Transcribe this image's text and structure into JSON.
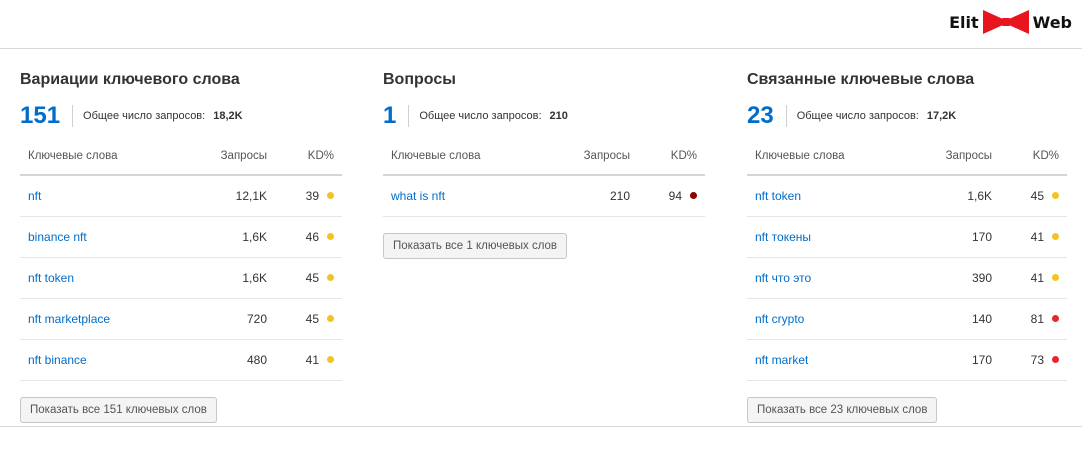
{
  "brand": {
    "left": "Elit",
    "right": "Web",
    "bow_color": "#e8141e"
  },
  "colors": {
    "accent": "#006dca",
    "kd_yellow": "#f5c224",
    "kd_red": "#e8262e",
    "kd_darkred": "#8b0000"
  },
  "columns": {
    "keyword": "Ключевые слова",
    "volume": "Запросы",
    "kd": "KD%"
  },
  "total_label": "Общее число запросов:",
  "panels": [
    {
      "title": "Вариации ключевого слова",
      "count": "151",
      "total": "18,2K",
      "rows": [
        {
          "keyword": "nft",
          "volume": "12,1K",
          "kd": "39",
          "kd_color": "#f5c224"
        },
        {
          "keyword": "binance nft",
          "volume": "1,6K",
          "kd": "46",
          "kd_color": "#f5c224"
        },
        {
          "keyword": "nft token",
          "volume": "1,6K",
          "kd": "45",
          "kd_color": "#f5c224"
        },
        {
          "keyword": "nft marketplace",
          "volume": "720",
          "kd": "45",
          "kd_color": "#f5c224"
        },
        {
          "keyword": "nft binance",
          "volume": "480",
          "kd": "41",
          "kd_color": "#f5c224"
        }
      ],
      "button": "Показать все 151 ключевых слов"
    },
    {
      "title": "Вопросы",
      "count": "1",
      "total": "210",
      "rows": [
        {
          "keyword": "what is nft",
          "volume": "210",
          "kd": "94",
          "kd_color": "#8b0000"
        }
      ],
      "button": "Показать все 1 ключевых слов"
    },
    {
      "title": "Связанные ключевые слова",
      "count": "23",
      "total": "17,2K",
      "rows": [
        {
          "keyword": "nft token",
          "volume": "1,6K",
          "kd": "45",
          "kd_color": "#f5c224"
        },
        {
          "keyword": "nft токены",
          "volume": "170",
          "kd": "41",
          "kd_color": "#f5c224"
        },
        {
          "keyword": "nft что это",
          "volume": "390",
          "kd": "41",
          "kd_color": "#f5c224"
        },
        {
          "keyword": "nft crypto",
          "volume": "140",
          "kd": "81",
          "kd_color": "#e8262e"
        },
        {
          "keyword": "nft market",
          "volume": "170",
          "kd": "73",
          "kd_color": "#e8262e"
        }
      ],
      "button": "Показать все 23 ключевых слов"
    }
  ]
}
